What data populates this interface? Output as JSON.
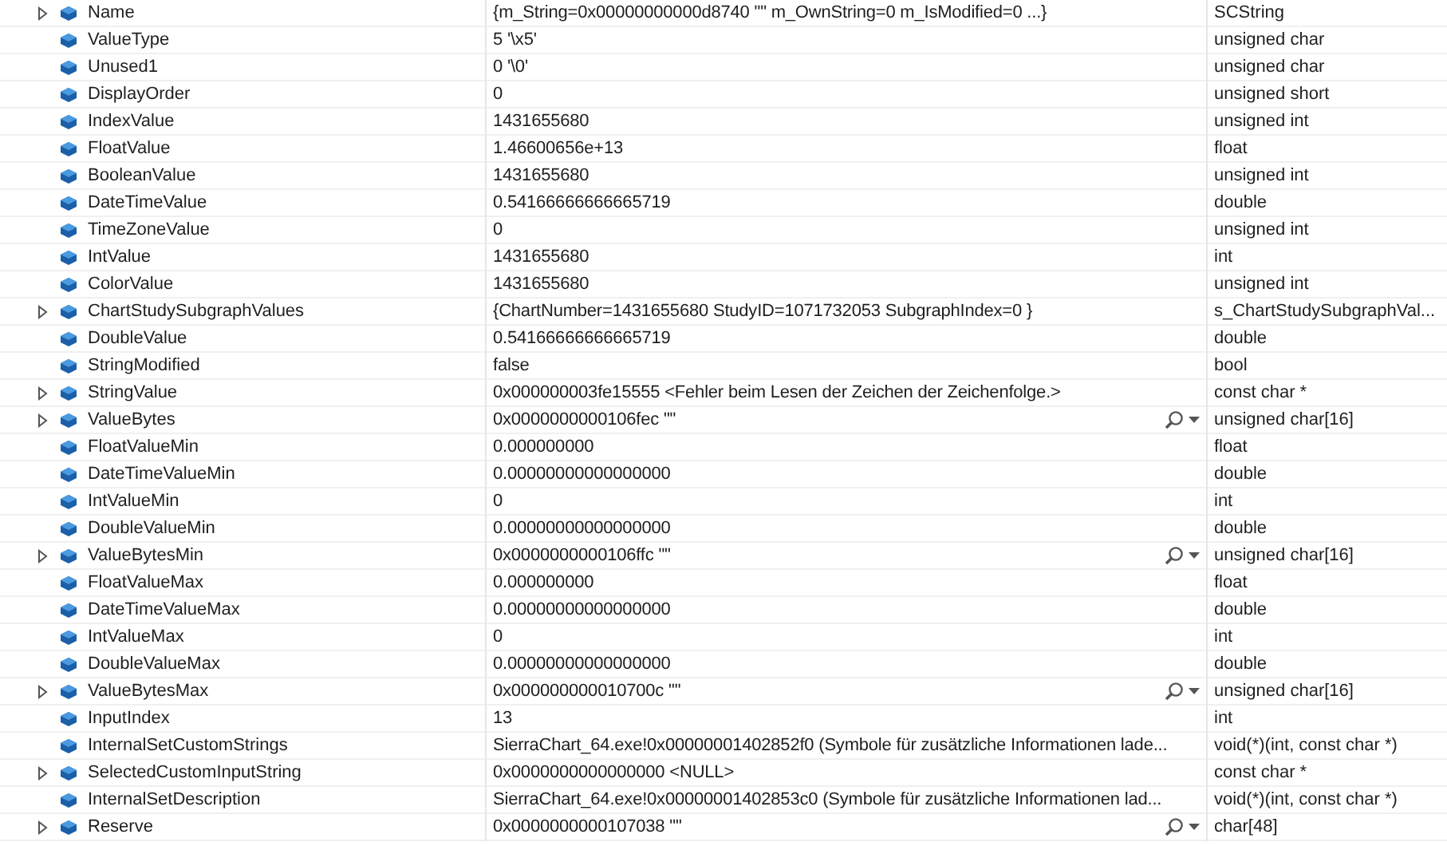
{
  "watch": {
    "rows": [
      {
        "name": "Name",
        "value": "{m_String=0x00000000000d8740 \"\" m_OwnString=0 m_IsModified=0 ...}",
        "type": "SCString",
        "expandable": true,
        "visualizer": false
      },
      {
        "name": "ValueType",
        "value": "5 '\\x5'",
        "type": "unsigned char",
        "expandable": false,
        "visualizer": false
      },
      {
        "name": "Unused1",
        "value": "0 '\\0'",
        "type": "unsigned char",
        "expandable": false,
        "visualizer": false
      },
      {
        "name": "DisplayOrder",
        "value": "0",
        "type": "unsigned short",
        "expandable": false,
        "visualizer": false
      },
      {
        "name": "IndexValue",
        "value": "1431655680",
        "type": "unsigned int",
        "expandable": false,
        "visualizer": false
      },
      {
        "name": "FloatValue",
        "value": "1.46600656e+13",
        "type": "float",
        "expandable": false,
        "visualizer": false
      },
      {
        "name": "BooleanValue",
        "value": "1431655680",
        "type": "unsigned int",
        "expandable": false,
        "visualizer": false
      },
      {
        "name": "DateTimeValue",
        "value": "0.54166666666665719",
        "type": "double",
        "expandable": false,
        "visualizer": false
      },
      {
        "name": "TimeZoneValue",
        "value": "0",
        "type": "unsigned int",
        "expandable": false,
        "visualizer": false
      },
      {
        "name": "IntValue",
        "value": "1431655680",
        "type": "int",
        "expandable": false,
        "visualizer": false
      },
      {
        "name": "ColorValue",
        "value": "1431655680",
        "type": "unsigned int",
        "expandable": false,
        "visualizer": false
      },
      {
        "name": "ChartStudySubgraphValues",
        "value": "{ChartNumber=1431655680 StudyID=1071732053 SubgraphIndex=0 }",
        "type": "s_ChartStudySubgraphVal...",
        "expandable": true,
        "visualizer": false
      },
      {
        "name": "DoubleValue",
        "value": "0.54166666666665719",
        "type": "double",
        "expandable": false,
        "visualizer": false
      },
      {
        "name": "StringModified",
        "value": "false",
        "type": "bool",
        "expandable": false,
        "visualizer": false
      },
      {
        "name": "StringValue",
        "value": "0x000000003fe15555 <Fehler beim Lesen der Zeichen der Zeichenfolge.>",
        "type": "const char *",
        "expandable": true,
        "visualizer": false
      },
      {
        "name": "ValueBytes",
        "value": "0x0000000000106fec \"\"",
        "type": "unsigned char[16]",
        "expandable": true,
        "visualizer": true
      },
      {
        "name": "FloatValueMin",
        "value": "0.000000000",
        "type": "float",
        "expandable": false,
        "visualizer": false
      },
      {
        "name": "DateTimeValueMin",
        "value": "0.00000000000000000",
        "type": "double",
        "expandable": false,
        "visualizer": false
      },
      {
        "name": "IntValueMin",
        "value": "0",
        "type": "int",
        "expandable": false,
        "visualizer": false
      },
      {
        "name": "DoubleValueMin",
        "value": "0.00000000000000000",
        "type": "double",
        "expandable": false,
        "visualizer": false
      },
      {
        "name": "ValueBytesMin",
        "value": "0x0000000000106ffc \"\"",
        "type": "unsigned char[16]",
        "expandable": true,
        "visualizer": true
      },
      {
        "name": "FloatValueMax",
        "value": "0.000000000",
        "type": "float",
        "expandable": false,
        "visualizer": false
      },
      {
        "name": "DateTimeValueMax",
        "value": "0.00000000000000000",
        "type": "double",
        "expandable": false,
        "visualizer": false
      },
      {
        "name": "IntValueMax",
        "value": "0",
        "type": "int",
        "expandable": false,
        "visualizer": false
      },
      {
        "name": "DoubleValueMax",
        "value": "0.00000000000000000",
        "type": "double",
        "expandable": false,
        "visualizer": false
      },
      {
        "name": "ValueBytesMax",
        "value": "0x000000000010700c \"\"",
        "type": "unsigned char[16]",
        "expandable": true,
        "visualizer": true
      },
      {
        "name": "InputIndex",
        "value": "13",
        "type": "int",
        "expandable": false,
        "visualizer": false
      },
      {
        "name": "InternalSetCustomStrings",
        "value": "SierraChart_64.exe!0x00000001402852f0 (Symbole für zusätzliche Informationen lade...",
        "type": "void(*)(int, const char *)",
        "expandable": false,
        "visualizer": false
      },
      {
        "name": "SelectedCustomInputString",
        "value": "0x0000000000000000 <NULL>",
        "type": "const char *",
        "expandable": true,
        "visualizer": false
      },
      {
        "name": "InternalSetDescription",
        "value": "SierraChart_64.exe!0x00000001402853c0 (Symbole für zusätzliche Informationen lad...",
        "type": "void(*)(int, const char *)",
        "expandable": false,
        "visualizer": false
      },
      {
        "name": "Reserve",
        "value": "0x0000000000107038 \"\"",
        "type": "char[48]",
        "expandable": true,
        "visualizer": true
      }
    ]
  }
}
